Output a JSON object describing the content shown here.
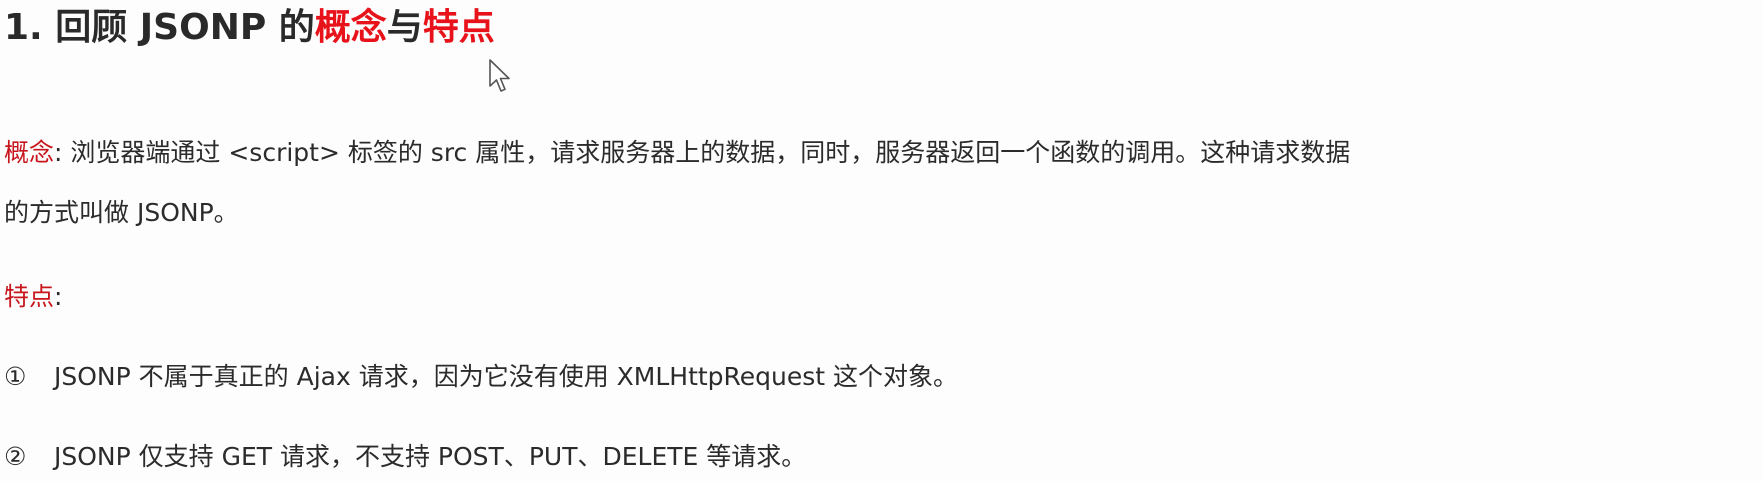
{
  "heading": {
    "prefix": "1. 回顾 JSONP 的",
    "highlight1": "概念",
    "middle": "与",
    "highlight2": "特点"
  },
  "concept": {
    "label": "概念",
    "colon": ":",
    "line1": " 浏览器端通过 <script> 标签的 src 属性，请求服务器上的数据，同时，服务器返回一个函数的调用。这种请求数据",
    "line2": "的方式叫做 JSONP。"
  },
  "features": {
    "label": "特点",
    "colon": ":",
    "items": [
      {
        "marker": "①",
        "text": "JSONP 不属于真正的 Ajax 请求，因为它没有使用 XMLHttpRequest 这个对象。"
      },
      {
        "marker": "②",
        "text": "JSONP 仅支持 GET 请求，不支持 POST、PUT、DELETE 等请求。"
      }
    ]
  },
  "colors": {
    "accent_red": "#e8121b",
    "label_red": "#c8161d",
    "text": "#2b2b2b"
  },
  "icons": [
    "mouse-cursor-icon"
  ]
}
